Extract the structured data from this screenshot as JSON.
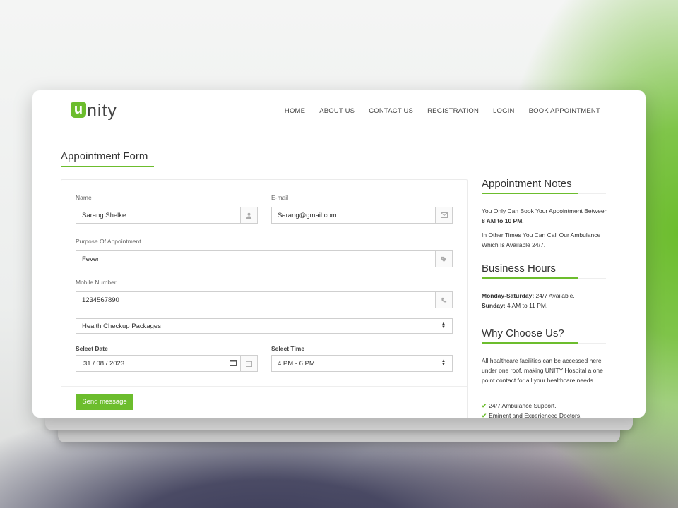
{
  "header": {
    "logo_initial": "u",
    "logo_rest": "nity",
    "nav": [
      "HOME",
      "ABOUT US",
      "CONTACT US",
      "REGISTRATION",
      "LOGIN",
      "BOOK APPOINTMENT"
    ]
  },
  "form": {
    "title": "Appointment Form",
    "name_label": "Name",
    "name_value": "Sarang Shelke",
    "email_label": "E-mail",
    "email_value": "Sarang@gmail.com",
    "purpose_label": "Purpose Of Appointment",
    "purpose_value": "Fever",
    "mobile_label": "Mobile Number",
    "mobile_value": "1234567890",
    "package_value": "Health Checkup Packages",
    "date_label": "Select Date",
    "date_value": "31 / 08 / 2023",
    "time_label": "Select Time",
    "time_value": "4 PM - 6 PM",
    "send_label": "Send message"
  },
  "sidebar": {
    "notes_title": "Appointment Notes",
    "notes_1_prefix": "You Only Can Book Your Appointment Between ",
    "notes_1_bold": "8 AM to 10 PM.",
    "notes_2": "In Other Times You Can Call Our Ambulance Which Is Available 24/7.",
    "hours_title": "Business Hours",
    "hours_1_label": "Monday-Saturday:",
    "hours_1_value": " 24/7 Available.",
    "hours_2_label": "Sunday:",
    "hours_2_value": " 4 AM to 11 PM.",
    "why_title": "Why Choose Us?",
    "why_text": "All healthcare facilities can be accessed here under one roof, making UNITY Hospital a one point contact for all your healthcare needs.",
    "why_points": [
      "24/7 Ambulance Support.",
      "Eminent and Experienced Doctors."
    ]
  },
  "colors": {
    "accent": "#6cbd2d",
    "text": "#333333"
  }
}
